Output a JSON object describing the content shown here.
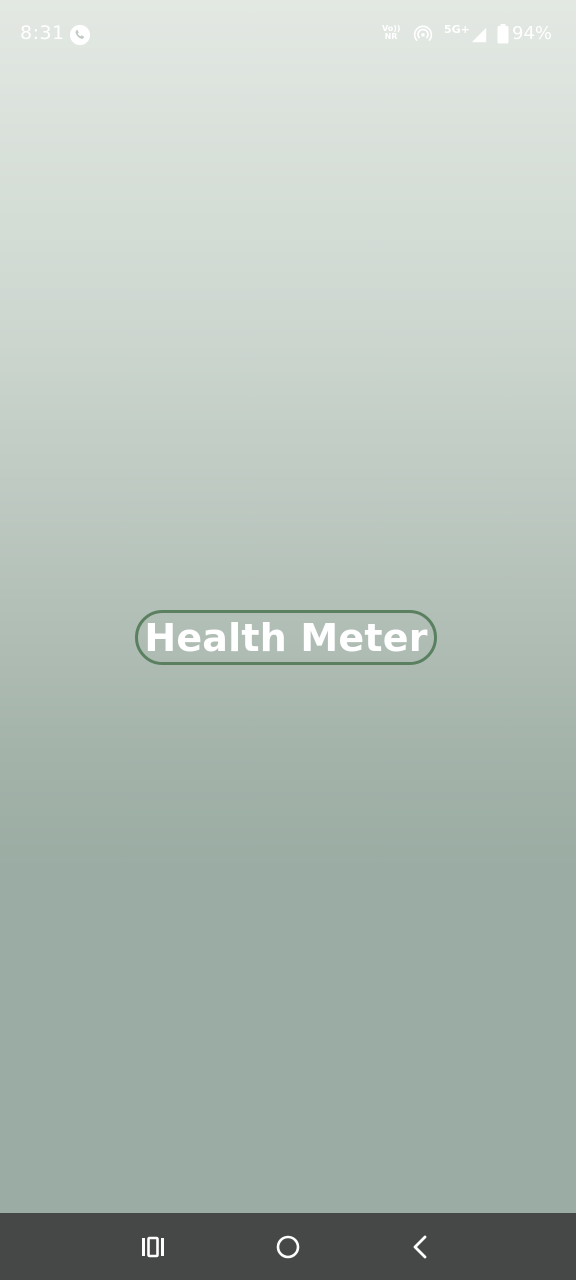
{
  "status_bar": {
    "time": "8:31",
    "volte_line1": "Vo))",
    "volte_line2": "NR",
    "network": "5G+",
    "battery_percent": "94%"
  },
  "app": {
    "title": "Health Meter",
    "accent_color": "#5a8060"
  },
  "nav_bar": {
    "recents_icon": "recents-icon",
    "home_icon": "home-icon",
    "back_icon": "back-icon"
  }
}
